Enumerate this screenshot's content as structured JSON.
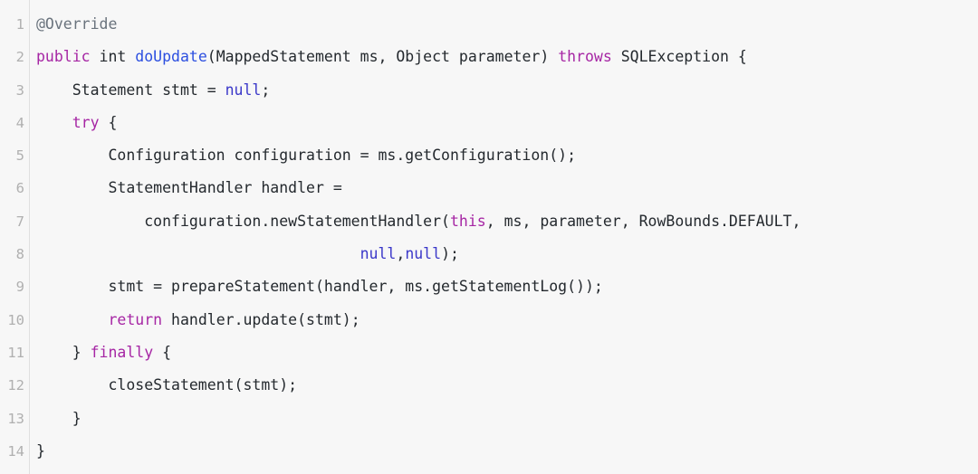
{
  "editor": {
    "language": "java",
    "background_color": "#f7f7f7",
    "gutter_divider_color": "#e0e0e0",
    "line_number_color": "#b0b0b0",
    "text_color": "#24292e",
    "keyword_color": "#a626a4",
    "function_color": "#2c4fe0",
    "constant_color": "#3b38c9",
    "annotation_color": "#6a737d",
    "line_numbers": [
      "1",
      "2",
      "3",
      "4",
      "5",
      "6",
      "7",
      "8",
      "9",
      "10",
      "11",
      "12",
      "13",
      "14"
    ],
    "lines": [
      {
        "number": "1",
        "text": "@Override",
        "tokens": [
          {
            "t": "@Override",
            "c": "anno"
          }
        ]
      },
      {
        "number": "2",
        "text": "public int doUpdate(MappedStatement ms, Object parameter) throws SQLException {",
        "tokens": [
          {
            "t": "public",
            "c": "kw"
          },
          {
            "t": " int ",
            "c": "plain"
          },
          {
            "t": "doUpdate",
            "c": "fn"
          },
          {
            "t": "(MappedStatement ms, Object parameter) ",
            "c": "plain"
          },
          {
            "t": "throws",
            "c": "kw"
          },
          {
            "t": " SQLException {",
            "c": "plain"
          }
        ]
      },
      {
        "number": "3",
        "text": "    Statement stmt = null;",
        "tokens": [
          {
            "t": "    Statement stmt = ",
            "c": "plain"
          },
          {
            "t": "null",
            "c": "const"
          },
          {
            "t": ";",
            "c": "plain"
          }
        ]
      },
      {
        "number": "4",
        "text": "    try {",
        "tokens": [
          {
            "t": "    ",
            "c": "plain"
          },
          {
            "t": "try",
            "c": "kw"
          },
          {
            "t": " {",
            "c": "plain"
          }
        ]
      },
      {
        "number": "5",
        "text": "        Configuration configuration = ms.getConfiguration();",
        "tokens": [
          {
            "t": "        Configuration configuration = ms.getConfiguration();",
            "c": "plain"
          }
        ]
      },
      {
        "number": "6",
        "text": "        StatementHandler handler =",
        "tokens": [
          {
            "t": "        StatementHandler handler =",
            "c": "plain"
          }
        ]
      },
      {
        "number": "7",
        "text": "            configuration.newStatementHandler(this, ms, parameter, RowBounds.DEFAULT,",
        "tokens": [
          {
            "t": "            configuration.newStatementHandler(",
            "c": "plain"
          },
          {
            "t": "this",
            "c": "kw"
          },
          {
            "t": ", ms, parameter, RowBounds.DEFAULT,",
            "c": "plain"
          }
        ]
      },
      {
        "number": "8",
        "text": "                                    null,null);",
        "tokens": [
          {
            "t": "                                    ",
            "c": "plain"
          },
          {
            "t": "null",
            "c": "const"
          },
          {
            "t": ",",
            "c": "plain"
          },
          {
            "t": "null",
            "c": "const"
          },
          {
            "t": ");",
            "c": "plain"
          }
        ]
      },
      {
        "number": "9",
        "text": "        stmt = prepareStatement(handler, ms.getStatementLog());",
        "tokens": [
          {
            "t": "        stmt = prepareStatement(handler, ms.getStatementLog());",
            "c": "plain"
          }
        ]
      },
      {
        "number": "10",
        "text": "        return handler.update(stmt);",
        "tokens": [
          {
            "t": "        ",
            "c": "plain"
          },
          {
            "t": "return",
            "c": "kw"
          },
          {
            "t": " handler.update(stmt);",
            "c": "plain"
          }
        ]
      },
      {
        "number": "11",
        "text": "    } finally {",
        "tokens": [
          {
            "t": "    } ",
            "c": "plain"
          },
          {
            "t": "finally",
            "c": "kw"
          },
          {
            "t": " {",
            "c": "plain"
          }
        ]
      },
      {
        "number": "12",
        "text": "        closeStatement(stmt);",
        "tokens": [
          {
            "t": "        closeStatement(stmt);",
            "c": "plain"
          }
        ]
      },
      {
        "number": "13",
        "text": "    }",
        "tokens": [
          {
            "t": "    }",
            "c": "plain"
          }
        ]
      },
      {
        "number": "14",
        "text": "}",
        "tokens": [
          {
            "t": "}",
            "c": "plain"
          }
        ]
      }
    ]
  }
}
